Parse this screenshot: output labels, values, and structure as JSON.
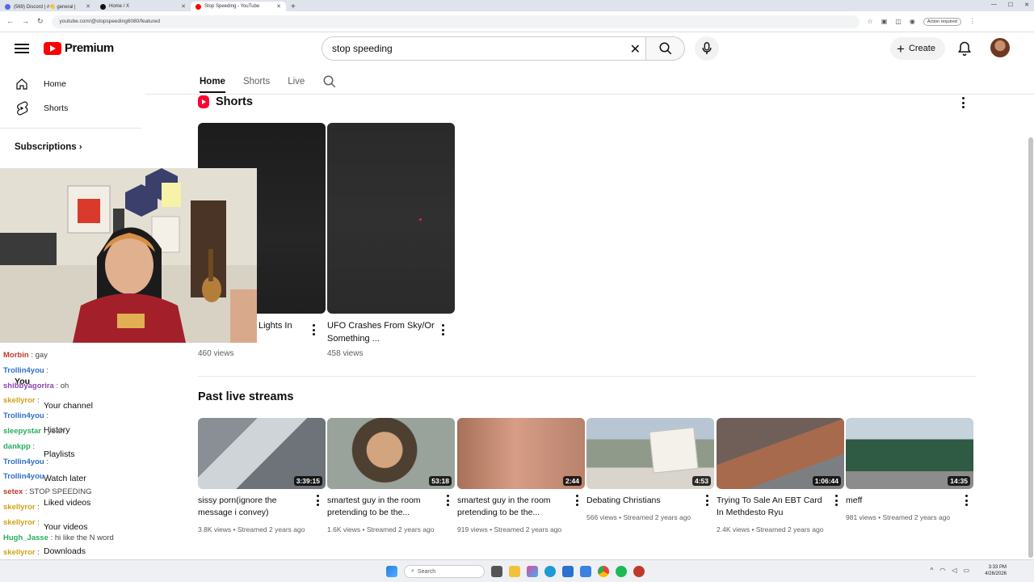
{
  "browser": {
    "tabs": [
      {
        "title": "(569) Discord | #👋 general |",
        "color": "#5865f2"
      },
      {
        "title": "Home / X",
        "color": "#111111"
      },
      {
        "title": "Stop Speeding - YouTube",
        "color": "#ff0000"
      }
    ],
    "new_tab": "+",
    "url": "youtube.com/@stopspeeding6080/featured",
    "action_required": "Action required"
  },
  "header": {
    "logo_text": "Premium",
    "search_value": "stop speeding",
    "search_placeholder": "Search",
    "create_label": "Create"
  },
  "sidebar": {
    "items": [
      {
        "label": "Home",
        "icon": "home-icon"
      },
      {
        "label": "Shorts",
        "icon": "shorts-icon"
      }
    ],
    "subscriptions_label": "Subscriptions",
    "you_label": "You",
    "you_items": [
      "Your channel",
      "History",
      "Playlists",
      "Watch later",
      "Liked videos",
      "Your videos",
      "Downloads"
    ]
  },
  "channel_tabs": [
    "Home",
    "Shorts",
    "Live"
  ],
  "shorts": {
    "title": "Shorts",
    "items": [
      {
        "title": "Lights In",
        "views": "460 views"
      },
      {
        "title": "UFO Crashes From Sky/Or Something ...",
        "views": "458 views"
      }
    ]
  },
  "past_streams": {
    "title": "Past live streams",
    "items": [
      {
        "title": "sissy porn(ignore the message i convey)",
        "duration": "3:39:15",
        "views": "3.8K views",
        "age": "Streamed 2 years ago"
      },
      {
        "title": "smartest guy in the room pretending to be the...",
        "duration": "53:18",
        "views": "1.6K views",
        "age": "Streamed 2 years ago"
      },
      {
        "title": "smartest guy in the room pretending to be the...",
        "duration": "2:44",
        "views": "919 views",
        "age": "Streamed 2 years ago"
      },
      {
        "title": "Debating Christians",
        "duration": "4:53",
        "views": "566 views",
        "age": "Streamed 2 years ago"
      },
      {
        "title": "Trying To Sale An EBT Card In Methdesto Ryu",
        "duration": "1:06:44",
        "views": "2.4K views",
        "age": "Streamed 2 years ago"
      },
      {
        "title": "meff",
        "duration": "14:35",
        "views": "981 views",
        "age": "Streamed 2 years ago"
      }
    ]
  },
  "chat": [
    {
      "user": "Morbin",
      "msg": ": gay",
      "color": "#c0392b"
    },
    {
      "user": "Trollin4you",
      "msg": ":",
      "color": "#2e6fc9"
    },
    {
      "user": "shibbyagorira",
      "msg": ": oh",
      "color": "#8e44ad"
    },
    {
      "user": "skellyror",
      "msg": ":",
      "color": "#d4a017"
    },
    {
      "user": "Trollin4you",
      "msg": ":",
      "color": "#2e6fc9"
    },
    {
      "user": "sleepystar",
      "msg": ": yeah",
      "color": "#27ae60"
    },
    {
      "user": "dankpp",
      "msg": ":",
      "color": "#27ae60"
    },
    {
      "user": "Trollin4you",
      "msg": ":",
      "color": "#2e6fc9"
    },
    {
      "user": "Trollin4you",
      "msg": ":",
      "color": "#2e6fc9"
    },
    {
      "user": "setex",
      "msg": ": STOP SPEEDING",
      "color": "#c0392b"
    },
    {
      "user": "skellyror",
      "msg": ":",
      "color": "#d4a017"
    },
    {
      "user": "skellyror",
      "msg": ":",
      "color": "#d4a017"
    },
    {
      "user": "Hugh_Jasse",
      "msg": ": hi like the N word",
      "color": "#27ae60"
    },
    {
      "user": "skellyror",
      "msg": ":",
      "color": "#d4a017"
    },
    {
      "user": "skellyror",
      "msg": ":",
      "color": "#d4a017"
    }
  ],
  "taskbar": {
    "search_label": "Search",
    "time": "3:33 PM",
    "date": "4/26/2026"
  }
}
